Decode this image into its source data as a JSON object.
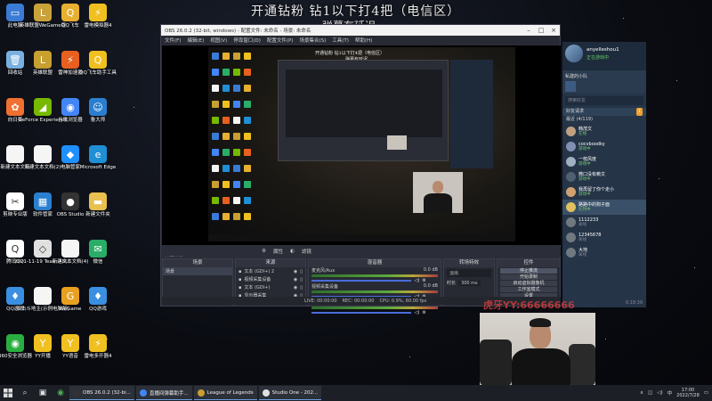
{
  "overlay": {
    "title": "开通钻粉 钻1以下打4把（电信区）",
    "subtitle": "弹幕有延迟"
  },
  "desktop_icons": [
    {
      "label": "此电脑",
      "color": "#3a7bd5",
      "glyph": "▭"
    },
    {
      "label": "英雄联盟WeGame版",
      "color": "#caa23a",
      "glyph": "L"
    },
    {
      "label": "QQ飞车",
      "color": "#e8b030",
      "glyph": "Q"
    },
    {
      "label": "雷电模拟器4",
      "color": "#f0c020",
      "glyph": "⚡"
    },
    {
      "label": "回收站",
      "color": "#7ab0e0",
      "glyph": "🗑"
    },
    {
      "label": "英雄联盟",
      "color": "#c8a030",
      "glyph": "L"
    },
    {
      "label": "雷神加速器",
      "color": "#e86020",
      "glyph": "⚡"
    },
    {
      "label": "QQ飞车助手工具",
      "color": "#f0c020",
      "glyph": "Q"
    },
    {
      "label": "向日葵",
      "color": "#f07030",
      "glyph": "✿"
    },
    {
      "label": "GeForce Experience",
      "color": "#76b900",
      "glyph": "◢"
    },
    {
      "label": "谷歌浏览器",
      "color": "#4285f4",
      "glyph": "◉"
    },
    {
      "label": "鲁大师",
      "color": "#2a7fd0",
      "glyph": "☺"
    },
    {
      "label": "新建文本文档",
      "color": "#f5f5f5",
      "glyph": ""
    },
    {
      "label": "新建文本文档(2)",
      "color": "#f5f5f5",
      "glyph": ""
    },
    {
      "label": "电脑管家",
      "color": "#1e90ff",
      "glyph": "◆"
    },
    {
      "label": "Microsoft Edge",
      "color": "#1f8fd6",
      "glyph": "e"
    },
    {
      "label": "剪映专业版",
      "color": "#ffffff",
      "glyph": "✂"
    },
    {
      "label": "软件管家",
      "color": "#2a7fd0",
      "glyph": "▦"
    },
    {
      "label": "OBS Studio",
      "color": "#333333",
      "glyph": "●"
    },
    {
      "label": "新建文件夹",
      "color": "#e8c050",
      "glyph": "▬"
    },
    {
      "label": "腾讯QQ",
      "color": "#ffffff",
      "glyph": "Q"
    },
    {
      "label": "2021-11-19 Team AIR...",
      "color": "#e0e0e0",
      "glyph": "◇"
    },
    {
      "label": "新建文本文档(4)",
      "color": "#f5f5f5",
      "glyph": ""
    },
    {
      "label": "微信",
      "color": "#2aae67",
      "glyph": "✉"
    },
    {
      "label": "QQ游戏",
      "color": "#3a8fe0",
      "glyph": "♦"
    },
    {
      "label": "双击斗地主(示例电脑版)",
      "color": "#f5f5f5",
      "glyph": ""
    },
    {
      "label": "WeGame",
      "color": "#e8a020",
      "glyph": "G"
    },
    {
      "label": "QQ游戏",
      "color": "#3a8fe0",
      "glyph": "♦"
    },
    {
      "label": "360安全浏览器",
      "color": "#2aae40",
      "glyph": "◉"
    },
    {
      "label": "YY开播",
      "color": "#f0c020",
      "glyph": "Y"
    },
    {
      "label": "YY语音",
      "color": "#f0c020",
      "glyph": "Y"
    },
    {
      "label": "雷电多开器4",
      "color": "#f0c020",
      "glyph": "⚡"
    }
  ],
  "obs": {
    "window_title": "OBS 26.0.2 (32-bit, windows) - 配置文件: 未命名 - 场景: 未命名",
    "menu": [
      "文件(F)",
      "编辑(E)",
      "视图(V)",
      "停靠窗口(D)",
      "配置文件(P)",
      "场景集合(S)",
      "工具(T)",
      "帮助(H)"
    ],
    "nested_title": "开通钻粉 钻1以下打4把（电信区）",
    "nested_sub": "弹幕有延迟",
    "toolbar": {
      "properties": "属性",
      "filters": "滤镜"
    },
    "current_scene": "未选择源",
    "docks": {
      "scenes": {
        "title": "场景",
        "items": [
          "场景"
        ]
      },
      "sources": {
        "title": "来源",
        "items": [
          "文本 (GDI+) 2",
          "视频采集设备",
          "文本 (GDI+)",
          "显示器采集"
        ]
      },
      "mixer": {
        "title": "混音器",
        "channels": [
          {
            "name": "麦克风/Aux",
            "db": "0.0 dB"
          },
          {
            "name": "视频采集设备",
            "db": "0.0 dB"
          },
          {
            "name": "桌面音频",
            "db": "0.0 dB"
          }
        ]
      },
      "transitions": {
        "title": "转场特效",
        "type": "淡出",
        "duration_label": "时长",
        "duration": "300 ms"
      },
      "controls": {
        "title": "控件",
        "buttons": [
          "停止推流",
          "开始录制",
          "启动虚拟摄像机",
          "工作室模式",
          "设置",
          "退出"
        ]
      }
    },
    "status": {
      "live": "LIVE: 00:00:00",
      "rec": "REC: 00:00:00",
      "cpu": "CPU: 0.9%, 60.00 fps"
    }
  },
  "chat_panel": {
    "username": "anyelleshou1",
    "status": "正在游戏中",
    "team_label": "私建的小队",
    "search_placeholder": "搜索好友",
    "group_header": "好友请求",
    "badge": "1",
    "group_name": "最近 (4/119)",
    "friends": [
      {
        "name": "韩茂文",
        "sub": "在线",
        "color": "#c0a080"
      },
      {
        "name": "cocvboodky",
        "sub": "游戏中",
        "color": "#8090b0"
      },
      {
        "name": "一枝风度",
        "sub": "游戏中",
        "color": "#a0b0c0"
      },
      {
        "name": "微口没有赖文",
        "sub": "游戏中",
        "color": "#506070"
      },
      {
        "name": "我再留了你个走小",
        "sub": "游戏中",
        "color": "#d0a070"
      },
      {
        "name": "路路中的狗子面",
        "sub": "队列中",
        "color": "#e0c060"
      },
      {
        "name": "1112233",
        "sub": "离线",
        "color": "#707880"
      },
      {
        "name": "12345678",
        "sub": "离线",
        "color": "#707880"
      },
      {
        "name": "大地",
        "sub": "离线",
        "color": "#707880"
      }
    ],
    "footer": "0:19:39"
  },
  "watermark": "虎牙YY:66666666",
  "taskbar": {
    "apps": [
      {
        "label": "OBS 26.0.2 (32-bi...",
        "color": "#333"
      },
      {
        "label": "直播间弹幕助手...",
        "color": "#4285f4"
      },
      {
        "label": "League of Legends",
        "color": "#c8a030"
      },
      {
        "label": "Studio One - 202...",
        "color": "#e0e0e0"
      }
    ],
    "time": "17:00",
    "date": "2022/7/28"
  }
}
